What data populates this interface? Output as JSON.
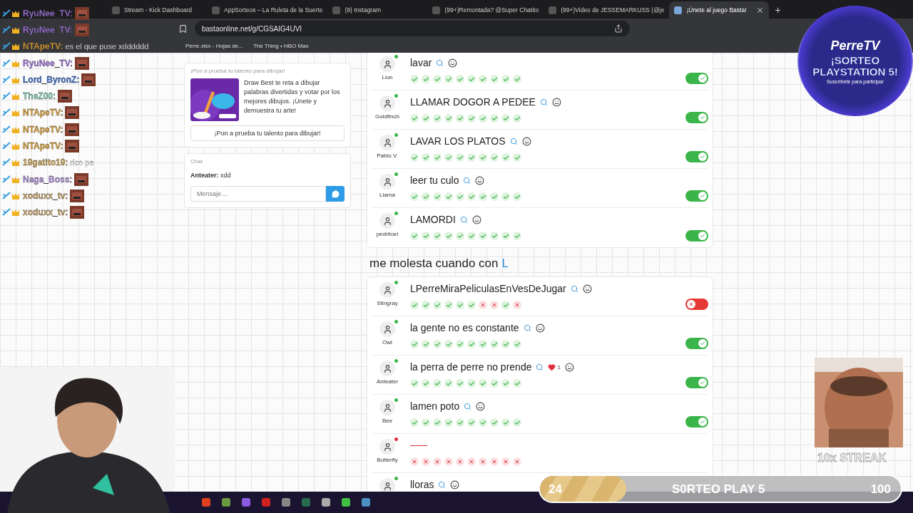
{
  "browser": {
    "tabs": [
      {
        "title": "Stream - Kick Dashboard",
        "selected": false
      },
      {
        "title": "AppSorteos – La Ruleta de la Suerte",
        "selected": false
      },
      {
        "title": "(9) Instagram",
        "selected": false
      },
      {
        "title": "(99+)Remontada? @Super Chatito",
        "selected": false
      },
      {
        "title": "(99+)Video de JESSEMARKUSS (@je",
        "selected": false
      },
      {
        "title": "¡Únete al juego Basta!",
        "selected": true
      }
    ],
    "new_tab": "+",
    "url": "bastaonline.net/g/CGSAIG4UVI",
    "bookmarks": [
      "Perre.xlsx - Hojas de...",
      "The Thing • HBO Max"
    ]
  },
  "promo": {
    "title": "¡Pon a prueba tu talento para dibujar!",
    "text": "Draw Best te reta a dibujar palabras divertidas y votar por los mejores dibujos. ¡Únete y demuestra tu arte!",
    "button": "¡Pon a prueba tu talento para dibujar!"
  },
  "chat": {
    "title": "Chat",
    "messages": [
      {
        "user": "Anteater:",
        "text": "xdd"
      }
    ],
    "placeholder": "Mensaje...."
  },
  "sections": [
    {
      "rows": [
        {
          "player": "Lion",
          "online": true,
          "answer": "lavar",
          "likes": null,
          "votes": [
            true,
            true,
            true,
            true,
            true,
            true,
            true,
            true,
            true,
            true
          ],
          "valid": true
        },
        {
          "player": "Goldfinch",
          "online": true,
          "answer": "LLAMAR DOGOR A PEDEE",
          "likes": null,
          "votes": [
            true,
            true,
            true,
            true,
            true,
            true,
            true,
            true,
            true,
            true
          ],
          "valid": true
        },
        {
          "player": "Pablo V.",
          "online": true,
          "answer": "LAVAR LOS PLATOS",
          "likes": null,
          "votes": [
            true,
            true,
            true,
            true,
            true,
            true,
            true,
            true,
            true,
            true
          ],
          "valid": true
        },
        {
          "player": "Llama",
          "online": true,
          "answer": "leer tu culo",
          "likes": null,
          "votes": [
            true,
            true,
            true,
            true,
            true,
            true,
            true,
            true,
            true,
            true
          ],
          "valid": true
        },
        {
          "player": "pedritoel",
          "online": true,
          "answer": "LAMORDI",
          "likes": null,
          "votes": [
            true,
            true,
            true,
            true,
            true,
            true,
            true,
            true,
            true,
            true
          ],
          "valid": true
        }
      ]
    },
    {
      "heading": "me molesta cuando con",
      "letter": "L",
      "rows": [
        {
          "player": "Stingray",
          "online": true,
          "answer": "LPerreMiraPeliculasEnVesDeJugar",
          "likes": null,
          "votes": [
            true,
            true,
            true,
            true,
            true,
            true,
            false,
            false,
            true,
            false
          ],
          "valid": false
        },
        {
          "player": "Owl",
          "online": true,
          "answer": "la gente no es constante",
          "likes": null,
          "votes": [
            true,
            true,
            true,
            true,
            true,
            true,
            true,
            true,
            true,
            true
          ],
          "valid": true
        },
        {
          "player": "Anteater",
          "online": true,
          "answer": "la perra de perre no prende",
          "likes": "1",
          "votes": [
            true,
            true,
            true,
            true,
            true,
            true,
            true,
            true,
            true,
            true
          ],
          "valid": true
        },
        {
          "player": "Bee",
          "online": true,
          "answer": "lamen poto",
          "likes": null,
          "votes": [
            true,
            true,
            true,
            true,
            true,
            true,
            true,
            true,
            true,
            true
          ],
          "valid": true
        },
        {
          "player": "Butterfly",
          "online": false,
          "answer": null,
          "likes": null,
          "votes": [
            false,
            false,
            false,
            false,
            false,
            false,
            false,
            false,
            false,
            false
          ],
          "valid": null
        },
        {
          "player": null,
          "online": true,
          "answer": "lloras",
          "likes": null,
          "votes": [],
          "valid": null
        }
      ]
    }
  ],
  "stream_chat": [
    {
      "user": "RyuNee_TV:",
      "color": "#a070e0"
    },
    {
      "user": "RyuNee_TV:",
      "color": "#a070e0"
    },
    {
      "user": "NTApeTV:",
      "color": "#e0a030",
      "text": "es el que puse xdddddd"
    },
    {
      "user": "RyuNee_TV:",
      "color": "#a070e0"
    },
    {
      "user": "Lord_ByronZ:",
      "color": "#3a6fd0"
    },
    {
      "user": "TheZ00:",
      "color": "#7fcfb8"
    },
    {
      "user": "NTApeTV:",
      "color": "#e0a030"
    },
    {
      "user": "NTApeTV:",
      "color": "#e0a030"
    },
    {
      "user": "NTApeTV:",
      "color": "#e0a030"
    },
    {
      "user": "19gatito19:",
      "color": "#d8a850",
      "text": "rico pe"
    },
    {
      "user": "Naga_Boss:",
      "color": "#b090e0"
    },
    {
      "user": "xoduxx_tv:",
      "color": "#c8a060"
    },
    {
      "user": "xoduxx_tv:",
      "color": "#c8a060"
    }
  ],
  "badge": {
    "brand": "PerreTV",
    "title": "¡SORTEO PLAYSTATION 5!",
    "subtitle": "Suscríbete para participar"
  },
  "streak": {
    "label": "10x STREAK"
  },
  "goal": {
    "current": "24",
    "title": "S0RTEO PLAY 5",
    "target": "100",
    "level": 0.24
  }
}
